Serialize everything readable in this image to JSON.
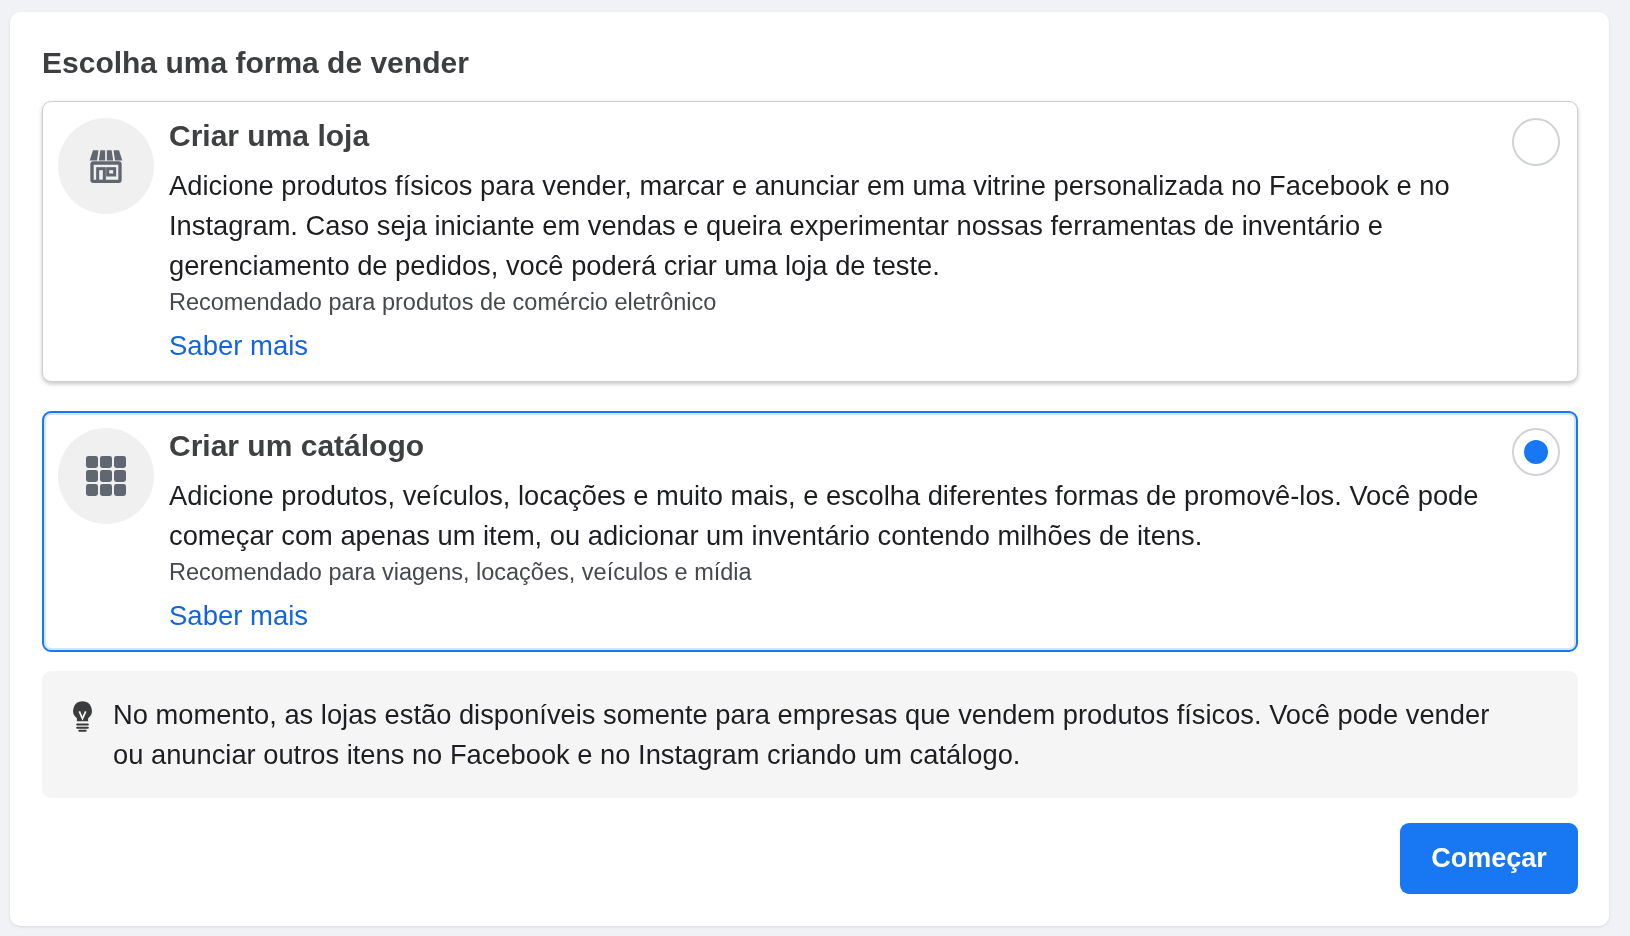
{
  "heading": "Escolha uma forma de vender",
  "options": [
    {
      "kind": "shop",
      "title": "Criar uma loja",
      "description": "Adicione produtos físicos para vender, marcar e anunciar em uma vitrine personalizada no Facebook e no Instagram. Caso seja iniciante em vendas e queira experimentar nossas ferramentas de inventário e gerenciamento de pedidos, você poderá criar uma loja de teste.",
      "recommendation": "Recomendado para produtos de comércio eletrônico",
      "link": "Saber mais",
      "selected": false
    },
    {
      "kind": "catalog",
      "title": "Criar um catálogo",
      "description": "Adicione produtos, veículos, locações e muito mais, e escolha diferentes formas de promovê-los. Você pode começar com apenas um item, ou adicionar um inventário contendo milhões de itens.",
      "recommendation": "Recomendado para viagens, locações, veículos e mídia",
      "link": "Saber mais",
      "selected": true
    }
  ],
  "notice": {
    "text": "No momento, as lojas estão disponíveis somente para empresas que vendem produtos físicos. Você pode vender ou anunciar outros itens no Facebook e no Instagram criando um catálogo."
  },
  "primary_button": "Começar"
}
